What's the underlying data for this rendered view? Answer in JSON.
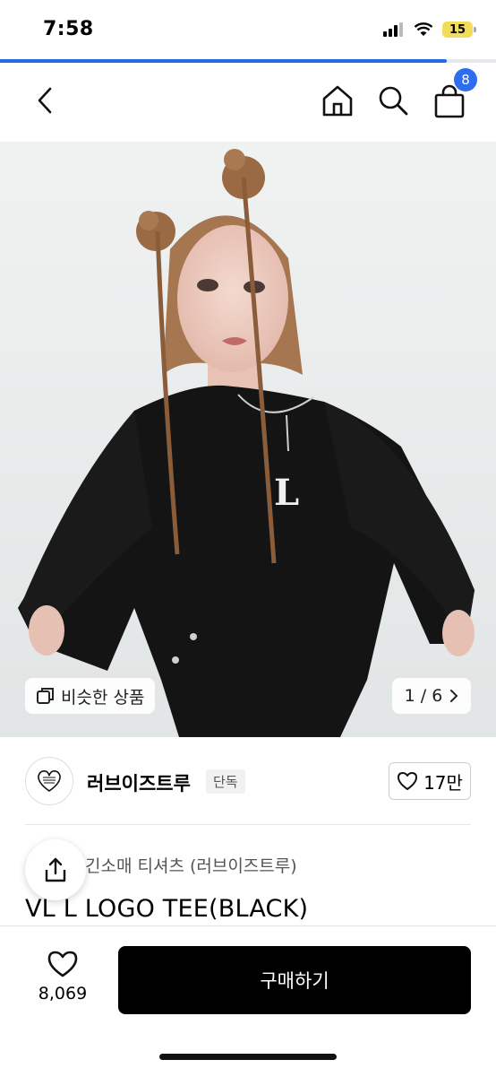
{
  "status_bar": {
    "time": "7:58",
    "battery": "15"
  },
  "page_progress": 0.9,
  "header": {
    "cart_count": "8"
  },
  "gallery": {
    "similar_label": "비슷한 상품",
    "pager": "1 / 6"
  },
  "brand": {
    "name": "러브이즈트루",
    "badge": "단독",
    "likes": "17만"
  },
  "product": {
    "category": "긴소매 티셔츠 (러브이즈트루)",
    "title": "VL L LOGO TEE(BLACK)"
  },
  "bottom": {
    "wish_count": "8,069",
    "buy_label": "구매하기"
  },
  "colors": {
    "accent": "#2f6df0",
    "buy_button": "#000000",
    "battery": "#f2dd5a"
  }
}
